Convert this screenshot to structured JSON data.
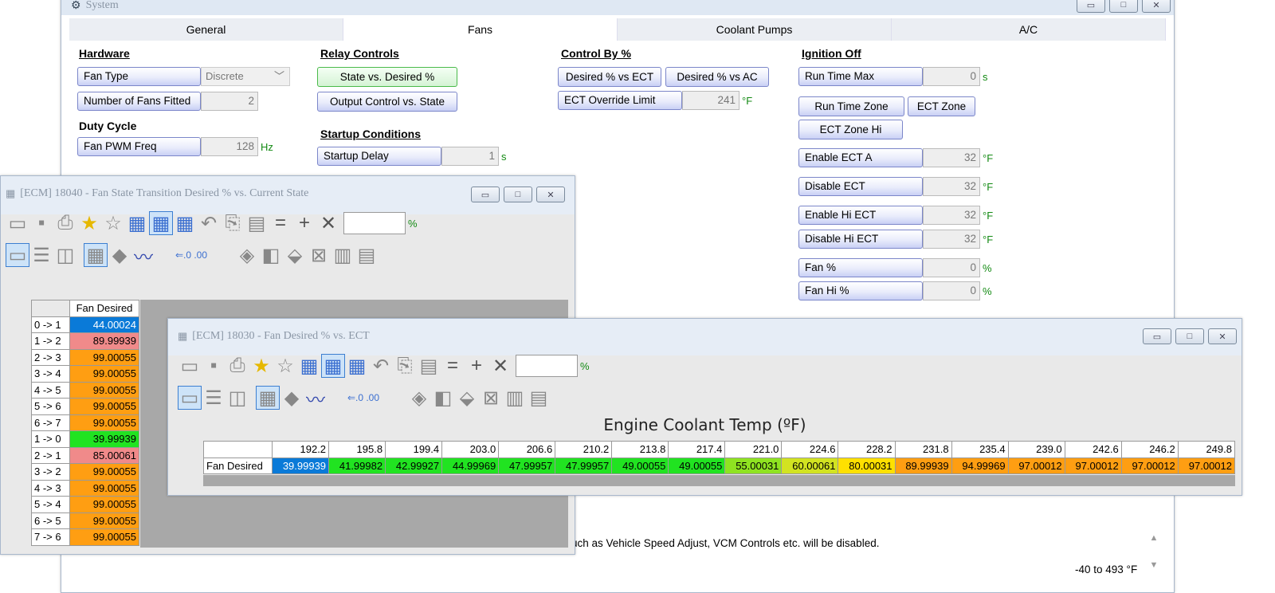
{
  "system": {
    "title": "System",
    "tabs": [
      "General",
      "Fans",
      "Coolant Pumps",
      "A/C"
    ],
    "active_tab": "Fans",
    "hardware": {
      "heading": "Hardware",
      "fan_type_label": "Fan Type",
      "fan_type_value": "Discrete",
      "num_fans_label": "Number of Fans Fitted",
      "num_fans_value": "2"
    },
    "duty": {
      "heading": "Duty Cycle",
      "pwm_label": "Fan PWM Freq",
      "pwm_value": "128",
      "pwm_unit": "Hz"
    },
    "relay": {
      "heading": "Relay Controls",
      "state_btn": "State vs. Desired %",
      "output_btn": "Output Control vs. State"
    },
    "startup": {
      "heading": "Startup Conditions",
      "delay_label": "Startup Delay",
      "delay_value": "1",
      "delay_unit": "s"
    },
    "control": {
      "heading": "Control By %",
      "ect_btn": "Desired % vs ECT",
      "ac_btn": "Desired % vs AC",
      "override_label": "ECT Override Limit",
      "override_value": "241",
      "override_unit": "°F"
    },
    "ignition": {
      "heading": "Ignition Off",
      "runtime_label": "Run Time Max",
      "runtime_value": "0",
      "runtime_unit": "s",
      "zone_btn": "Run Time Zone",
      "ect_zone_btn": "ECT Zone",
      "ect_zone_hi_btn": "ECT Zone Hi",
      "fields": [
        {
          "label": "Enable ECT A",
          "value": "32",
          "unit": "°F"
        },
        {
          "label": "Disable ECT",
          "value": "32",
          "unit": "°F"
        },
        {
          "label": "Enable Hi ECT",
          "value": "32",
          "unit": "°F"
        },
        {
          "label": "Disable Hi ECT",
          "value": "32",
          "unit": "°F"
        },
        {
          "label": "Fan %",
          "value": "0",
          "unit": "%"
        },
        {
          "label": "Fan Hi %",
          "value": "0",
          "unit": "%"
        }
      ]
    },
    "status_text": "uch as Vehicle Speed Adjust, VCM Controls etc. will be disabled.",
    "range_text": "-40 to 493 °F"
  },
  "win1": {
    "title": "[ECM] 18040 - Fan State Transition Desired % vs. Current State",
    "pct_unit": "%",
    "col_header": "Fan Desired",
    "rows": [
      {
        "label": "0 -> 1",
        "value": "44.00024",
        "color": "#0a7ad8"
      },
      {
        "label": "1 -> 2",
        "value": "89.99939",
        "color": "#f08a8a"
      },
      {
        "label": "2 -> 3",
        "value": "99.00055",
        "color": "#ff9e12"
      },
      {
        "label": "3 -> 4",
        "value": "99.00055",
        "color": "#ff9e12"
      },
      {
        "label": "4 -> 5",
        "value": "99.00055",
        "color": "#ff9e12"
      },
      {
        "label": "5 -> 6",
        "value": "99.00055",
        "color": "#ff9e12"
      },
      {
        "label": "6 -> 7",
        "value": "99.00055",
        "color": "#ff9e12"
      },
      {
        "label": "1 -> 0",
        "value": "39.99939",
        "color": "#21e321"
      },
      {
        "label": "2 -> 1",
        "value": "85.00061",
        "color": "#f08a8a"
      },
      {
        "label": "3 -> 2",
        "value": "99.00055",
        "color": "#ff9e12"
      },
      {
        "label": "4 -> 3",
        "value": "99.00055",
        "color": "#ff9e12"
      },
      {
        "label": "5 -> 4",
        "value": "99.00055",
        "color": "#ff9e12"
      },
      {
        "label": "6 -> 5",
        "value": "99.00055",
        "color": "#ff9e12"
      },
      {
        "label": "7 -> 6",
        "value": "99.00055",
        "color": "#ff9e12"
      }
    ]
  },
  "win2": {
    "title": "[ECM] 18030 - Fan Desired % vs. ECT",
    "pct_unit": "%",
    "axis_title": "Engine Coolant Temp (ºF)",
    "row_label": "Fan Desired",
    "cols": [
      "192.2",
      "195.8",
      "199.4",
      "203.0",
      "206.6",
      "210.2",
      "213.8",
      "217.4",
      "221.0",
      "224.6",
      "228.2",
      "231.8",
      "235.4",
      "239.0",
      "242.6",
      "246.2",
      "249.8"
    ],
    "values": [
      "39.99939",
      "41.99982",
      "42.99927",
      "44.99969",
      "47.99957",
      "47.99957",
      "49.00055",
      "49.00055",
      "55.00031",
      "60.00061",
      "80.00031",
      "89.99939",
      "94.99969",
      "97.00012",
      "97.00012",
      "97.00012",
      "97.00012"
    ],
    "colors": [
      "#0a7ad8",
      "#21e321",
      "#21e321",
      "#21e321",
      "#21e321",
      "#21e321",
      "#21e321",
      "#21e321",
      "#8fe321",
      "#d2e321",
      "#ffe000",
      "#ff9e12",
      "#ff9e12",
      "#ff9e12",
      "#ff9e12",
      "#ff9e12",
      "#ff9e12"
    ]
  }
}
